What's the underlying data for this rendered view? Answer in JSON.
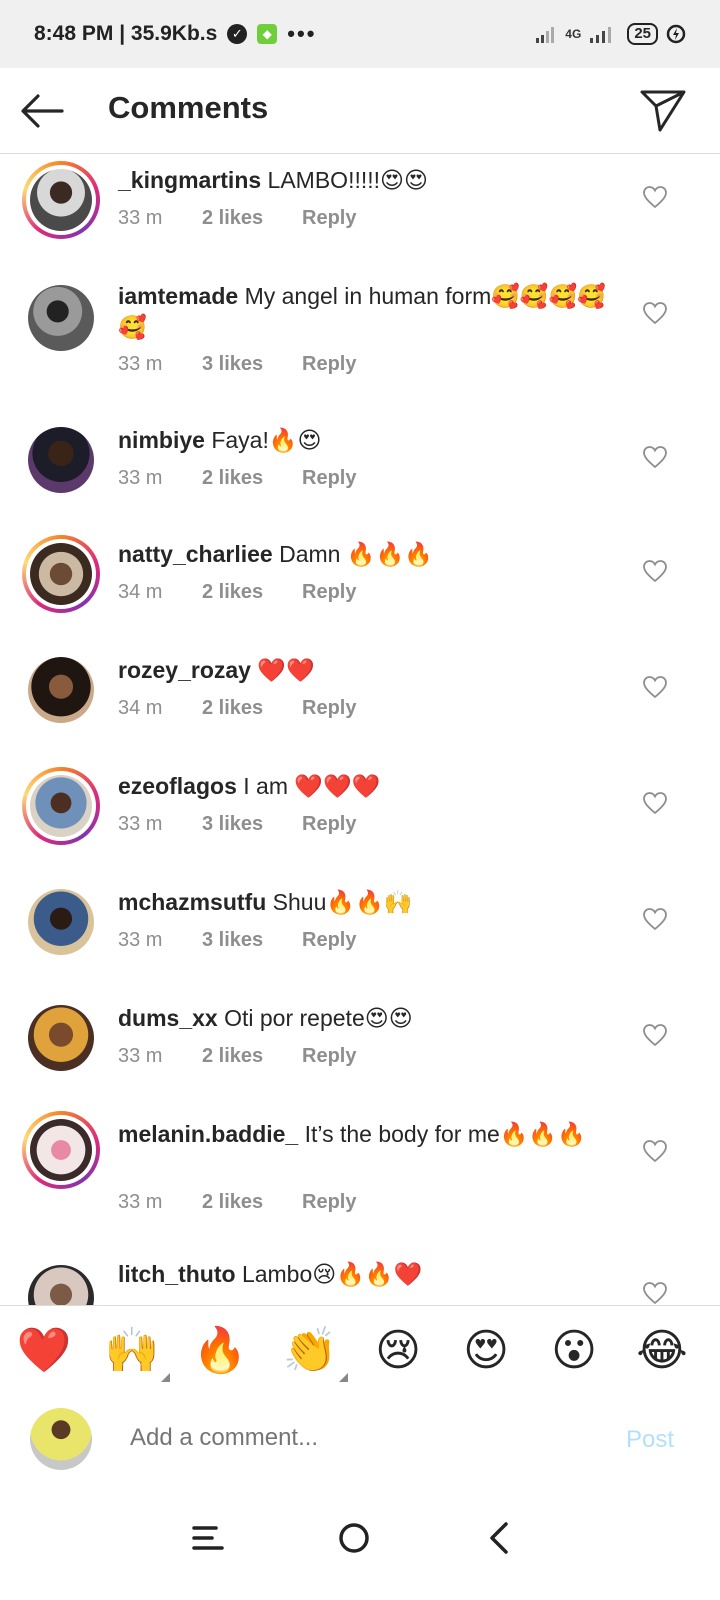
{
  "status_bar": {
    "time_speed": "8:48 PM | 35.9Kb.s",
    "dots": "•••",
    "network": "4G",
    "battery": "25"
  },
  "header": {
    "title": "Comments"
  },
  "comments": [
    {
      "user": "_kingmartins",
      "text": "LAMBO!!!!!😍😍",
      "time": "33 m",
      "likes": "2 likes",
      "reply": "Reply"
    },
    {
      "user": "iamtemade",
      "text": "My angel in human form🥰🥰🥰🥰🥰",
      "time": "33 m",
      "likes": "3 likes",
      "reply": "Reply"
    },
    {
      "user": "nimbiye",
      "text": "Faya!🔥😍",
      "time": "33 m",
      "likes": "2 likes",
      "reply": "Reply"
    },
    {
      "user": "natty_charliee",
      "text": "Damn 🔥🔥🔥",
      "time": "34 m",
      "likes": "2 likes",
      "reply": "Reply"
    },
    {
      "user": "rozey_rozay",
      "text": "❤️❤️",
      "time": "34 m",
      "likes": "2 likes",
      "reply": "Reply"
    },
    {
      "user": "ezeoflagos",
      "text": "I am ❤️❤️❤️",
      "time": "33 m",
      "likes": "3 likes",
      "reply": "Reply"
    },
    {
      "user": "mchazmsutfu",
      "text": "Shuu🔥🔥🙌",
      "time": "33 m",
      "likes": "3 likes",
      "reply": "Reply"
    },
    {
      "user": "dums_xx",
      "text": "Oti por repete😍😍",
      "time": "33 m",
      "likes": "2 likes",
      "reply": "Reply"
    },
    {
      "user": "melanin.baddie_",
      "text": "It’s the body for me🔥🔥🔥",
      "time": "33 m",
      "likes": "2 likes",
      "reply": "Reply"
    },
    {
      "user": "litch_thuto",
      "text": "Lambo😢🔥🔥❤️",
      "time": "",
      "likes": "",
      "reply": ""
    }
  ],
  "quick_emojis": [
    "❤️",
    "🙌",
    "🔥",
    "👏",
    "😢",
    "😍",
    "😮",
    "😂"
  ],
  "composer": {
    "placeholder": "Add a comment...",
    "post_label": "Post"
  },
  "colors": {
    "post_disabled": "#b2dffc",
    "meta_gray": "#8e8e8e",
    "text": "#262626"
  }
}
